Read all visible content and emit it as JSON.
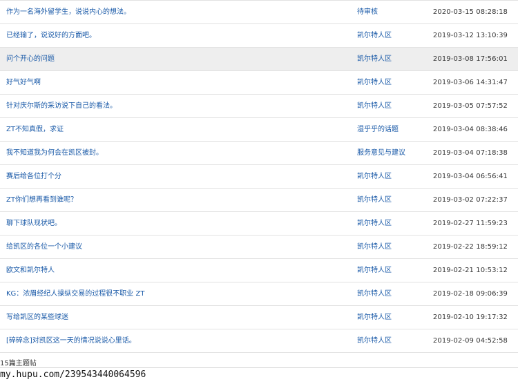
{
  "posts": [
    {
      "title": "作为一名海外留学生，说说内心的想法。",
      "board": "待审核",
      "date": "2020-03-15 08:28:18"
    },
    {
      "title": "已经输了，说说好的方面吧。",
      "board": "凯尔特人区",
      "date": "2019-03-12 13:10:39"
    },
    {
      "title": "问个开心的问题",
      "board": "凯尔特人区",
      "date": "2019-03-08 17:56:01"
    },
    {
      "title": "好气好气啊",
      "board": "凯尔特人区",
      "date": "2019-03-06 14:31:47"
    },
    {
      "title": "针对庆尔斯的采访说下自己的看法。",
      "board": "凯尔特人区",
      "date": "2019-03-05 07:57:52"
    },
    {
      "title": "ZT不知真假，求证",
      "board": "湿乎乎的话题",
      "date": "2019-03-04 08:38:46"
    },
    {
      "title": "我不知道我为何会在凯区被封。",
      "board": "服务意见与建议",
      "date": "2019-03-04 07:18:38"
    },
    {
      "title": "赛后给各位打个分",
      "board": "凯尔特人区",
      "date": "2019-03-04 06:56:41"
    },
    {
      "title": "ZT你们想再看到谁呢？",
      "board": "凯尔特人区",
      "date": "2019-03-02 07:22:37"
    },
    {
      "title": "聊下球队现状吧。",
      "board": "凯尔特人区",
      "date": "2019-02-27 11:59:23"
    },
    {
      "title": "给凯区的各位一个小建议",
      "board": "凯尔特人区",
      "date": "2019-02-22 18:59:12"
    },
    {
      "title": "欧文和凯尔特人",
      "board": "凯尔特人区",
      "date": "2019-02-21 10:53:12"
    },
    {
      "title": "KG：浓眉经纪人操纵交易的过程很不职业 ZT",
      "board": "凯尔特人区",
      "date": "2019-02-18 09:06:39"
    },
    {
      "title": "写给凯区的某些球迷",
      "board": "凯尔特人区",
      "date": "2019-02-10 19:17:32"
    },
    {
      "title": "[碎碎念]对凯区这一天的情况说说心里话。",
      "board": "凯尔特人区",
      "date": "2019-02-09 04:52:58"
    }
  ],
  "highlighted_row": 2,
  "footer": {
    "total": "15篇主题帖",
    "watermark": "my.hupu.com/239543440064596"
  },
  "colors": {
    "link": "#1a5aa8",
    "date_text": "#333333",
    "row_border": "#e1e1e1",
    "row_hover": "#eeeeee"
  }
}
